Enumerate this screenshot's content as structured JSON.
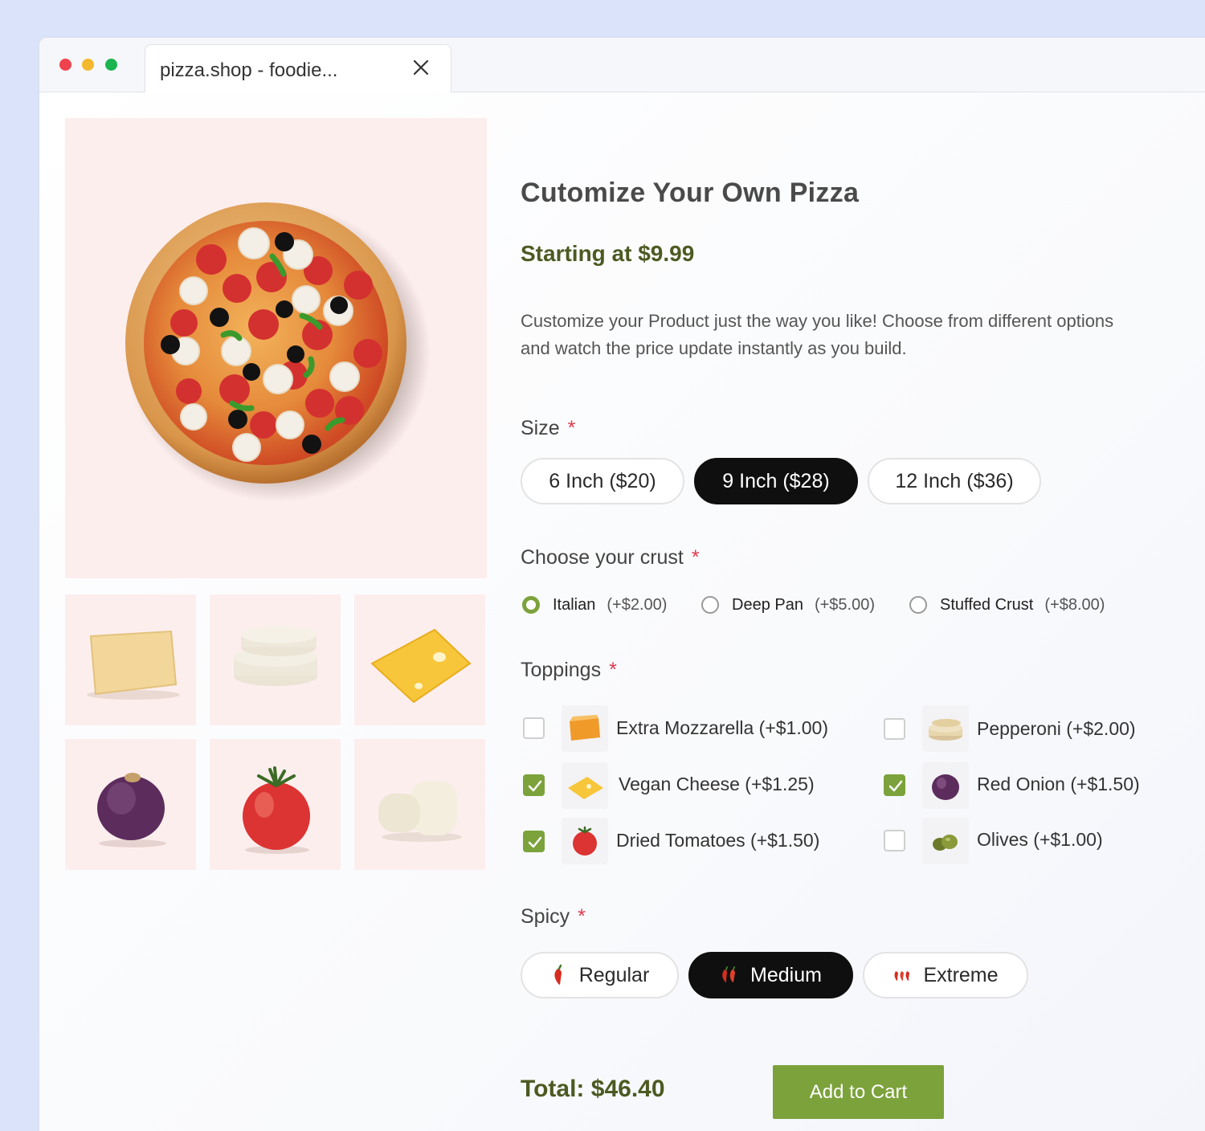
{
  "browser": {
    "tab_title": "pizza.shop - foodie..."
  },
  "product": {
    "title": "Cutomize Your Own Pizza",
    "starting_price": "Starting at $9.99",
    "description": "Customize your Product just the way you like! Choose from different options and watch the price update instantly as you build."
  },
  "size": {
    "label": "Size",
    "required_mark": "*",
    "options": [
      {
        "label": "6 Inch ($20)",
        "selected": false
      },
      {
        "label": "9 Inch ($28)",
        "selected": true
      },
      {
        "label": "12 Inch ($36)",
        "selected": false
      }
    ]
  },
  "crust": {
    "label": "Choose your crust",
    "required_mark": "*",
    "options": [
      {
        "label": "Italian",
        "price": "(+$2.00)",
        "selected": true
      },
      {
        "label": "Deep Pan",
        "price": "(+$5.00)",
        "selected": false
      },
      {
        "label": "Stuffed Crust",
        "price": "(+$8.00)",
        "selected": false
      }
    ]
  },
  "toppings": {
    "label": "Toppings",
    "required_mark": "*",
    "items": [
      {
        "label": "Extra Mozzarella (+$1.00)",
        "checked": false,
        "icon": "mozzarella-icon"
      },
      {
        "label": "Pepperoni (+$2.00)",
        "checked": false,
        "icon": "pepperoni-icon"
      },
      {
        "label": "Vegan Cheese (+$1.25)",
        "checked": true,
        "icon": "vegan-cheese-icon"
      },
      {
        "label": "Red Onion (+$1.50)",
        "checked": true,
        "icon": "red-onion-icon"
      },
      {
        "label": "Dried Tomatoes (+$1.50)",
        "checked": true,
        "icon": "tomato-icon"
      },
      {
        "label": "Olives (+$1.00)",
        "checked": false,
        "icon": "olives-icon"
      }
    ]
  },
  "spicy": {
    "label": "Spicy",
    "required_mark": "*",
    "options": [
      {
        "label": "Regular",
        "selected": false,
        "icon": "chili-one-icon"
      },
      {
        "label": "Medium",
        "selected": true,
        "icon": "chili-two-icon"
      },
      {
        "label": "Extreme",
        "selected": false,
        "icon": "chili-three-icon"
      }
    ]
  },
  "cart": {
    "total": "Total: $46.40",
    "button_label": "Add to Cart"
  },
  "colors": {
    "accent_green": "#7ca23c",
    "price_green": "#4c5a22",
    "selected_pill": "#0f0f0f",
    "required_red": "#e03a4f",
    "image_bg": "#fdeeee"
  }
}
